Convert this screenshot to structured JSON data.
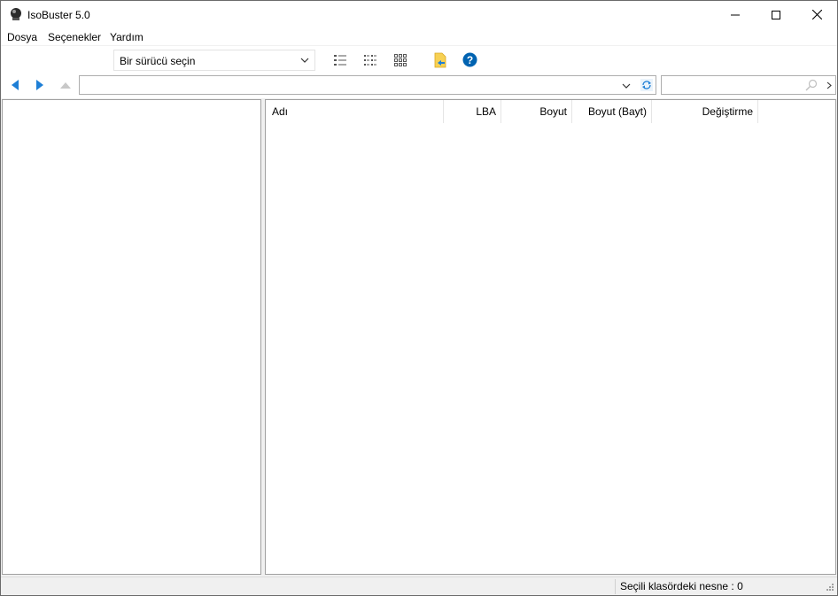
{
  "window": {
    "title": "IsoBuster 5.0"
  },
  "menu": {
    "items": [
      "Dosya",
      "Seçenekler",
      "Yardım"
    ]
  },
  "toolbar": {
    "drive_select": "Bir sürücü seçin",
    "icons": [
      "details-view-icon",
      "list-view-icon",
      "grid-view-icon",
      "extract-icon",
      "help-icon"
    ]
  },
  "address": {
    "path": "",
    "search": ""
  },
  "file_list": {
    "columns": [
      "Adı",
      "LBA",
      "Boyut",
      "Boyut (Bayt)",
      "Değiştirme"
    ],
    "rows": []
  },
  "status": {
    "text": "Seçili klasördeki nesne : 0"
  },
  "colors": {
    "accent_blue": "#1e7fd6",
    "help_blue": "#0063b1",
    "folder_yellow": "#f7d154"
  }
}
